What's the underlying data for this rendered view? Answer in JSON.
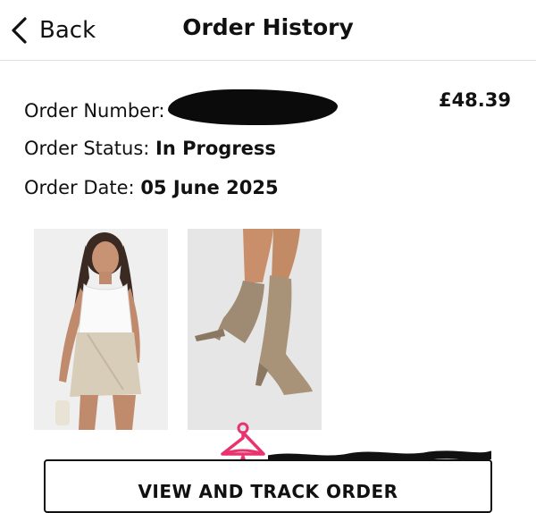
{
  "header": {
    "back_label": "Back",
    "title": "Order History"
  },
  "order": {
    "number_label": "Order Number:",
    "price": "£48.39",
    "status_label": "Order Status:",
    "status_value": "In Progress",
    "date_label": "Order Date:",
    "date_value": "05 June 2025"
  },
  "products": [
    {
      "icon": "woman-in-white-top-and-beige-skirt"
    },
    {
      "icon": "taupe-suede-heeled-boots"
    }
  ],
  "action": {
    "button_label": "VIEW AND TRACK ORDER"
  },
  "colors": {
    "accent": "#e8336f",
    "text": "#111111",
    "divider": "#e2e2e2"
  }
}
